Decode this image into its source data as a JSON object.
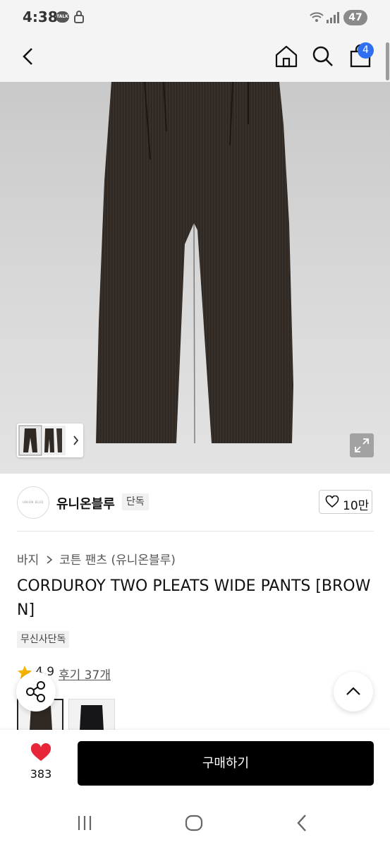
{
  "status_bar": {
    "time": "4:38",
    "talk_badge": "TALK",
    "battery": "47"
  },
  "nav": {
    "cart_count": "4",
    "icons": [
      "back-arrow-icon",
      "home-icon",
      "search-icon",
      "shopping-bag-icon"
    ]
  },
  "brand": {
    "logo_text": "UNION BLUE",
    "name": "유니온블루",
    "exclusive_label": "단독",
    "likes": "10만"
  },
  "product": {
    "breadcrumb": [
      "바지",
      "코튼 팬츠 (유니온블루)"
    ],
    "title": "CORDUROY TWO PLEATS WIDE PANTS [BROWN]",
    "store_tag": "무신사단독",
    "rating": "4.9",
    "review_link": "후기 37개",
    "colors": [
      "brown",
      "black"
    ]
  },
  "bottom_bar": {
    "heart_count": "383",
    "buy_label": "구매하기"
  },
  "colors": {
    "accent_blue": "#2d6ff0",
    "heart_red": "#e8263a",
    "star_yellow": "#f5b400",
    "buy_black": "#000000"
  }
}
